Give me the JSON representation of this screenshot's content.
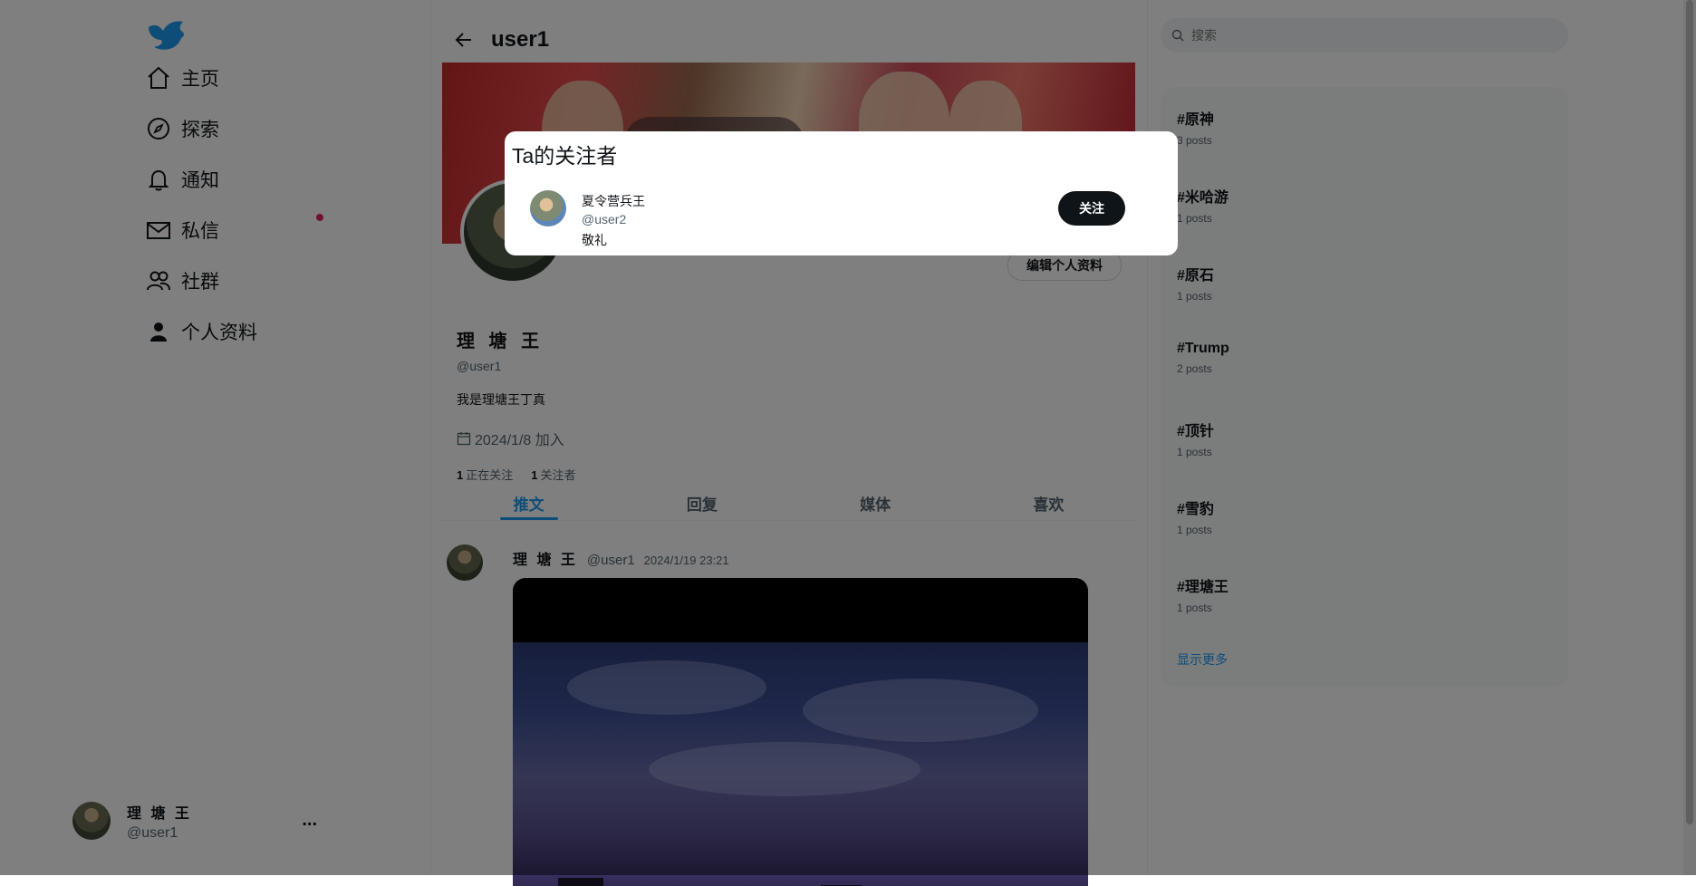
{
  "sidebar": {
    "items": [
      {
        "label": "主页",
        "icon": "home-icon"
      },
      {
        "label": "探索",
        "icon": "compass-icon"
      },
      {
        "label": "通知",
        "icon": "bell-icon"
      },
      {
        "label": "私信",
        "icon": "mail-icon"
      },
      {
        "label": "社群",
        "icon": "people-icon"
      },
      {
        "label": "个人资料",
        "icon": "person-icon"
      }
    ],
    "account": {
      "name": "理 塘 王",
      "handle": "@user1",
      "more": "..."
    }
  },
  "header": {
    "title": "user1"
  },
  "profile": {
    "name": "理 塘 王",
    "handle": "@user1",
    "bio": "我是理塘王丁真",
    "joined": "2024/1/8 加入",
    "following_count": "1",
    "following_label": "正在关注",
    "followers_count": "1",
    "followers_label": "关注者",
    "edit_label": "编辑个人资料"
  },
  "tabs": [
    {
      "label": "推文",
      "active": true
    },
    {
      "label": "回复"
    },
    {
      "label": "媒体"
    },
    {
      "label": "喜欢"
    }
  ],
  "post": {
    "name": "理 塘 王",
    "handle": "@user1",
    "time": "2024/1/19 23:21"
  },
  "search": {
    "placeholder": "搜索"
  },
  "trends": [
    {
      "tag": "#原神",
      "count": "3 posts"
    },
    {
      "tag": "#米哈游",
      "count": "1 posts"
    },
    {
      "tag": "#原石",
      "count": "1 posts"
    },
    {
      "tag": "#Trump",
      "count": "2 posts"
    },
    {
      "tag": "#顶针",
      "count": "1 posts"
    },
    {
      "tag": "#雪豹",
      "count": "1 posts"
    },
    {
      "tag": "#理塘王",
      "count": "1 posts"
    }
  ],
  "trends_more": "显示更多",
  "modal": {
    "title": "Ta的关注者",
    "user": {
      "name": "夏令营兵王",
      "handle": "@user2",
      "bio": "敬礼"
    },
    "follow_label": "关注"
  },
  "colors": {
    "accent": "#1d9bf0",
    "badge": "#e0245e",
    "overlay": "rgba(0,0,0,0.5)"
  }
}
